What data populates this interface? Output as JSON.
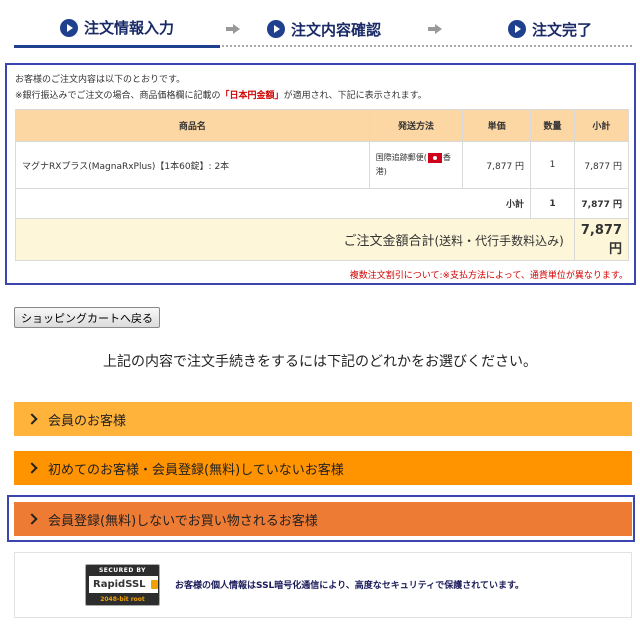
{
  "steps": {
    "step1": "注文情報入力",
    "step2": "注文内容確認",
    "step3": "注文完了"
  },
  "notes": {
    "line1": "お客様のご注文内容は以下のとおりです。",
    "line2_pre": "※銀行振込みでご注文の場合、商品価格欄に記載の",
    "line2_highlight": "「日本円金額」",
    "line2_post": "が適用され、下記に表示されます。"
  },
  "table": {
    "headers": [
      "商品名",
      "発送方法",
      "単価",
      "数量",
      "小計"
    ],
    "rows": [
      {
        "name": "マグナRXプラス(MagnaRxPlus)【1本60錠】: 2本",
        "shipping_pre": "国際追跡郵便(",
        "shipping_post": "香港)",
        "price": "7,877 円",
        "qty": "1",
        "subtotal": "7,877 円"
      }
    ],
    "subtotal_label": "小計",
    "subtotal_qty": "1",
    "subtotal_value": "7,877 円",
    "total_label": "ご注文金額合計",
    "total_label_paren": "(送料・代行手数料込み)",
    "total_value": "7,877円"
  },
  "coupon_note": "複数注文割引について:※支払方法によって、通貨単位が異なります。",
  "back_button": "ショッピングカートへ戻る",
  "instruction": "上記の内容で注文手続きをするには下記のどれかをお選びください。",
  "choices": {
    "member": "会員のお客様",
    "first_time": "初めてのお客様・会員登録(無料)していないお客様",
    "guest": "会員登録(無料)しないでお買い物されるお客様"
  },
  "ssl": {
    "badge_top": "SECURED BY",
    "badge_brand": "RapidSSL",
    "badge_bottom": "2048-bit root",
    "text": "お客様の個人情報はSSL暗号化通信により、高度なセキュリティで保護されています。"
  },
  "colors": {
    "accent_blue": "#1f3f8f",
    "outline_blue": "#3a45b0",
    "header_peach": "#fcd7a3",
    "total_bg": "#fdf6d8",
    "choice1": "#ffb33a",
    "choice2": "#ff9300",
    "choice3": "#ee7b34",
    "note_red": "#d00000"
  },
  "icons": {
    "step_icon": "play-circle-icon",
    "step_arrow": "arrow-right-icon",
    "choice_icon": "chevron-right-icon",
    "flag_icon": "hong-kong-flag-icon",
    "ssl_lock": "lock-icon"
  }
}
